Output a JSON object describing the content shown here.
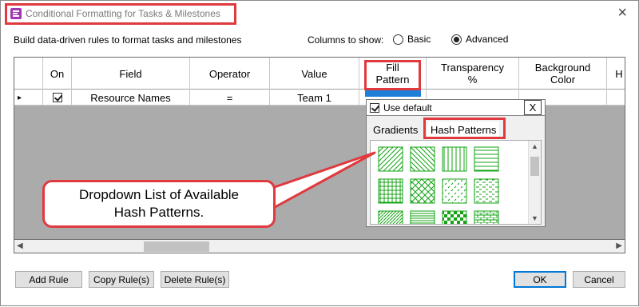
{
  "window": {
    "title": "Conditional Formatting for Tasks & Milestones",
    "close_glyph": "×"
  },
  "description": "Build data-driven rules to format tasks and milestones",
  "columns_to_show": {
    "label": "Columns to show:",
    "options": [
      "Basic",
      "Advanced"
    ],
    "selected": "Advanced"
  },
  "grid": {
    "headers": [
      {
        "label": ""
      },
      {
        "label": "On"
      },
      {
        "label": "Field"
      },
      {
        "label": "Operator"
      },
      {
        "label": "Value"
      },
      {
        "label": "Fill\nPattern"
      },
      {
        "label": "Transparency\n%"
      },
      {
        "label": "Background\nColor"
      },
      {
        "label": "H"
      }
    ],
    "rows": [
      {
        "selector": "▸",
        "on": true,
        "field": "Resource Names",
        "operator": "=",
        "value": "Team 1"
      }
    ],
    "accent_color": "#1e7fd9"
  },
  "popup": {
    "use_default_label": "Use default",
    "use_default_checked": true,
    "close_label": "X",
    "tabs": [
      "Gradients",
      "Hash Patterns"
    ],
    "active_tab": "Hash Patterns",
    "pattern_color": "#13a313",
    "patterns": [
      "diag-right",
      "diag-left",
      "vertical",
      "horizontal",
      "grid",
      "diag-cross",
      "dash-diag",
      "dash-horiz",
      "dense-diag",
      "dense-horiz",
      "checker",
      "brick"
    ]
  },
  "callout": {
    "lines": [
      "Dropdown List of Available",
      "Hash Patterns."
    ]
  },
  "buttons": {
    "add_rule": "Add Rule",
    "copy_rules": "Copy Rule(s)",
    "delete_rules": "Delete Rule(s)",
    "ok": "OK",
    "cancel": "Cancel"
  },
  "highlight_color": "#e0393e"
}
